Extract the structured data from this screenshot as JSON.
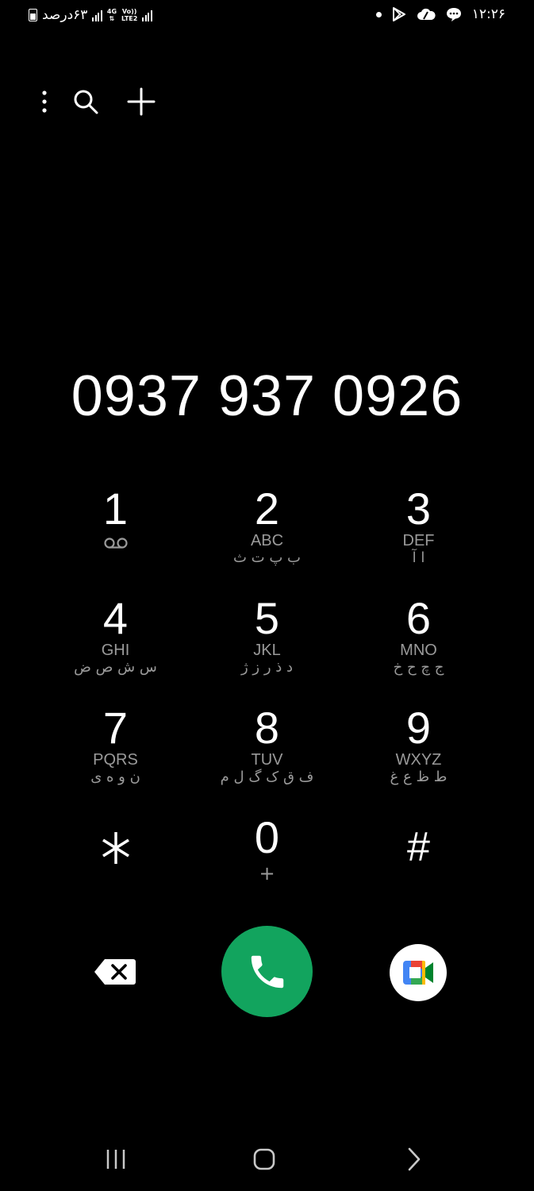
{
  "status_bar": {
    "battery_text": "۶۳درصد",
    "network_4g": "4G",
    "network_volte": "Vo))",
    "network_lte2": "LTE2",
    "time": "۱۲:۲۶"
  },
  "toolbar": {
    "more_icon": "more-vert-icon",
    "search_icon": "search-icon",
    "add_icon": "add-icon"
  },
  "dialed_number": "0937 937 0926",
  "keypad": [
    {
      "digit": "1",
      "latin": "",
      "persian": "",
      "extra": "voicemail-icon"
    },
    {
      "digit": "2",
      "latin": "ABC",
      "persian": "ب پ ت ث"
    },
    {
      "digit": "3",
      "latin": "DEF",
      "persian": "ا آ"
    },
    {
      "digit": "4",
      "latin": "GHI",
      "persian": "س ش ص ض"
    },
    {
      "digit": "5",
      "latin": "JKL",
      "persian": "د ذ ر ز ژ"
    },
    {
      "digit": "6",
      "latin": "MNO",
      "persian": "ج چ ح خ"
    },
    {
      "digit": "7",
      "latin": "PQRS",
      "persian": "ن و ه ی"
    },
    {
      "digit": "8",
      "latin": "TUV",
      "persian": "ف ق ک گ ل م"
    },
    {
      "digit": "9",
      "latin": "WXYZ",
      "persian": "ط ظ ع غ"
    },
    {
      "digit": "*",
      "latin": "",
      "persian": ""
    },
    {
      "digit": "0",
      "latin": "+",
      "persian": ""
    },
    {
      "digit": "#",
      "latin": "",
      "persian": ""
    }
  ],
  "actions": {
    "backspace_icon": "backspace-icon",
    "call_icon": "phone-icon",
    "meet_icon": "google-meet-icon",
    "call_color": "#12a45e"
  },
  "navbar": {
    "recents_icon": "recents-icon",
    "home_icon": "home-icon",
    "back_icon": "back-icon"
  }
}
